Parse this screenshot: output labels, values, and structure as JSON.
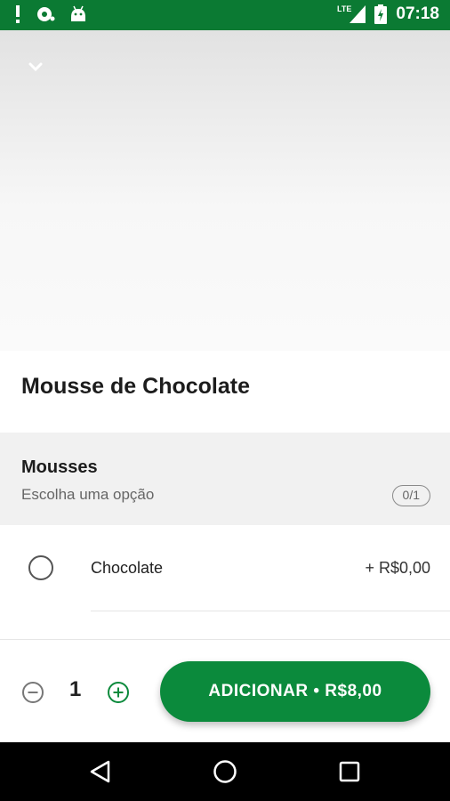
{
  "status_bar": {
    "time": "07:18",
    "network": "LTE",
    "icons": [
      "alert-icon",
      "sync-icon",
      "android-icon",
      "signal-icon",
      "battery-icon"
    ]
  },
  "product": {
    "title": "Mousse de Chocolate"
  },
  "option_group": {
    "title": "Mousses",
    "subtitle": "Escolha uma opção",
    "selection_count": "0/1",
    "options": [
      {
        "label": "Chocolate",
        "price": "+ R$0,00",
        "selected": false
      }
    ]
  },
  "cart": {
    "quantity": "1",
    "add_button_label": "ADICIONAR • R$8,00"
  },
  "colors": {
    "brand_green": "#0b8a3c",
    "status_bar": "#0b7a33"
  }
}
